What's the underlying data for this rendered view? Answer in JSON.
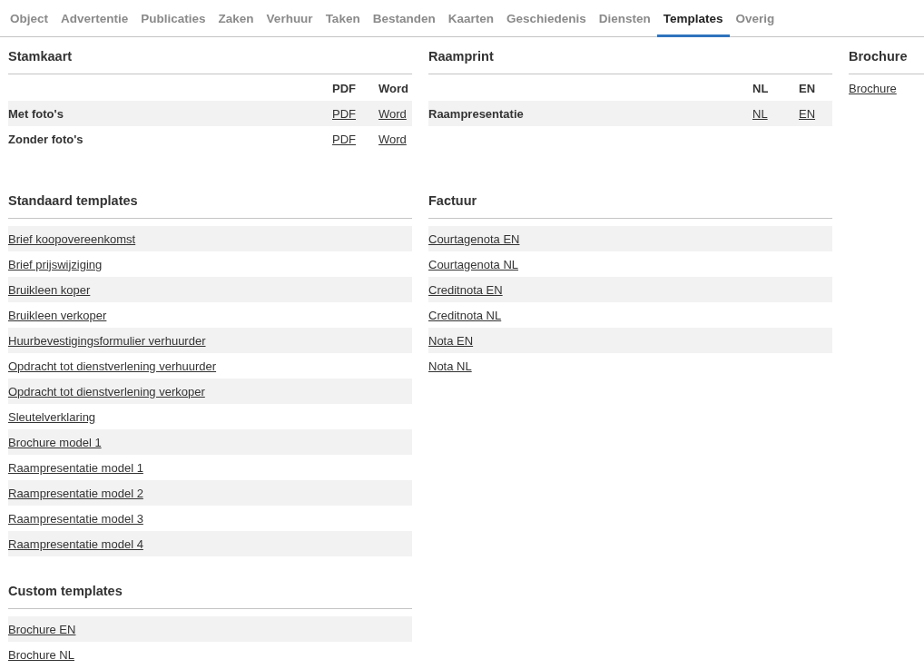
{
  "tabs": [
    {
      "label": "Object",
      "selected": false
    },
    {
      "label": "Advertentie",
      "selected": false
    },
    {
      "label": "Publicaties",
      "selected": false
    },
    {
      "label": "Zaken",
      "selected": false
    },
    {
      "label": "Verhuur",
      "selected": false
    },
    {
      "label": "Taken",
      "selected": false
    },
    {
      "label": "Bestanden",
      "selected": false
    },
    {
      "label": "Kaarten",
      "selected": false
    },
    {
      "label": "Geschiedenis",
      "selected": false
    },
    {
      "label": "Diensten",
      "selected": false
    },
    {
      "label": "Templates",
      "selected": true
    },
    {
      "label": "Overig",
      "selected": false
    }
  ],
  "rows": [
    {
      "sections": [
        {
          "kind": "matrix",
          "title": "Stamkaart",
          "columns": [
            "PDF",
            "Word"
          ],
          "rows": [
            {
              "label": "Met foto's",
              "links": [
                "PDF",
                "Word"
              ]
            },
            {
              "label": "Zonder foto's",
              "links": [
                "PDF",
                "Word"
              ]
            }
          ]
        },
        {
          "kind": "matrix",
          "title": "Raamprint",
          "columns": [
            "NL",
            "EN"
          ],
          "rows": [
            {
              "label": "Raampresentatie",
              "links": [
                "NL",
                "EN"
              ]
            }
          ]
        },
        {
          "kind": "list",
          "title": "Brochure",
          "striped": false,
          "links": [
            "Brochure"
          ]
        }
      ]
    },
    {
      "sections": [
        {
          "kind": "list",
          "title": "Standaard templates",
          "striped": true,
          "links": [
            "Brief koopovereenkomst",
            "Brief prijswijziging",
            "Bruikleen koper",
            "Bruikleen verkoper",
            "Huurbevestigingsformulier verhuurder",
            "Opdracht tot dienstverlening verhuurder",
            "Opdracht tot dienstverlening verkoper",
            "Sleutelverklaring",
            "Brochure model 1",
            "Raampresentatie model 1",
            "Raampresentatie model 2",
            "Raampresentatie model 3",
            "Raampresentatie model 4"
          ]
        },
        {
          "kind": "list",
          "title": "Factuur",
          "striped": true,
          "links": [
            "Courtagenota EN",
            "Courtagenota NL",
            "Creditnota EN",
            "Creditnota NL",
            "Nota EN",
            "Nota NL"
          ]
        }
      ]
    },
    {
      "sections": [
        {
          "kind": "list",
          "title": "Custom templates",
          "striped": true,
          "links": [
            "Brochure EN",
            "Brochure NL"
          ]
        }
      ]
    }
  ]
}
